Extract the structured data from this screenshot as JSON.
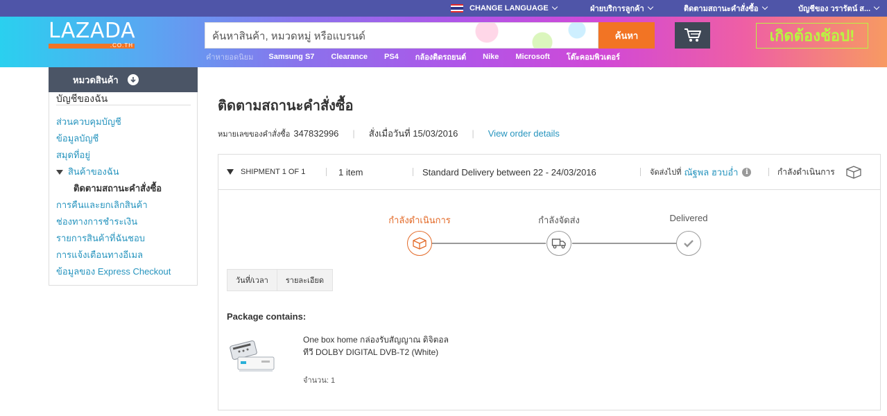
{
  "header": {
    "language_label": "CHANGE LANGUAGE",
    "customer_service": "ฝ่ายบริการลูกค้า",
    "track_order": "ติดตามสถานะคำสั่งซื้อ",
    "account": "บัญชีของ วรารัตน์ ส...",
    "logo_text": "LAZADA",
    "logo_sub": ".CO.TH",
    "search_placeholder": "ค้นหาสินค้า, หมวดหมู่ หรือแบรนด์",
    "search_button": "ค้นหา",
    "promo_text": "เกิดต้องช้อป!",
    "popular_label": "คำหายอดนิยม",
    "keywords": [
      "Samsung S7",
      "Clearance",
      "PS4",
      "กล้องติดรถยนต์",
      "Nike",
      "Microsoft",
      "โต๊ะคอมพิวเตอร์"
    ]
  },
  "sidebar": {
    "category_button": "หมวดสินค้า",
    "title": "บัญชีของฉัน",
    "items": [
      "ส่วนควบคุมบัญชี",
      "ข้อมูลบัญชี",
      "สมุดที่อยู่"
    ],
    "my_orders": "สินค้าของฉัน",
    "track_current": "ติดตามสถานะคำสั่งซื้อ",
    "items_after": [
      "การคืนและยกเลิกสินค้า",
      "ช่องทางการชำระเงิน",
      "รายการสินค้าที่ฉันชอบ",
      "การแจ้งเตือนทางอีเมล",
      "ข้อมูลของ Express Checkout"
    ]
  },
  "order": {
    "page_title": "ติดตามสถานะคำสั่งซื้อ",
    "order_number_label": "หมายเลขของคำสั่งซื้อ",
    "order_number": "347832996",
    "order_date": "สั่งเมื่อวันที่ 15/03/2016",
    "view_details": "View order details"
  },
  "shipment": {
    "title": "SHIPMENT 1 OF 1",
    "items": "1 item",
    "delivery": "Standard Delivery between 22 - 24/03/2016",
    "ship_to_label": "จัดส่งไปที่",
    "ship_to_name": "ณัฐพล ฮวบอ่ำ",
    "status": "กำลังดำเนินการ",
    "steps": [
      {
        "label": "กำลังดำเนินการ",
        "state": "active"
      },
      {
        "label": "กำลังจัดส่ง",
        "state": "pending"
      },
      {
        "label": "Delivered",
        "state": "pending"
      }
    ],
    "tabs": [
      "วันที่/เวลา",
      "รายละเอียด"
    ],
    "package_title": "Package contains:",
    "product_name": "One box home กล่องรับสัญญาณ ดิจิตอลทีวี DOLBY DIGITAL DVB-T2 (White)",
    "product_qty": "จำนวน: 1"
  },
  "colors": {
    "accent_orange": "#f27424",
    "link_blue": "#2694be",
    "top_bar": "#4f55a8",
    "category_button": "#4b5566"
  },
  "icons": [
    "flag-thailand-icon",
    "cart-icon",
    "arrow-down-circle-icon",
    "triangle-down-icon",
    "info-icon",
    "box-icon",
    "truck-icon",
    "check-icon"
  ]
}
